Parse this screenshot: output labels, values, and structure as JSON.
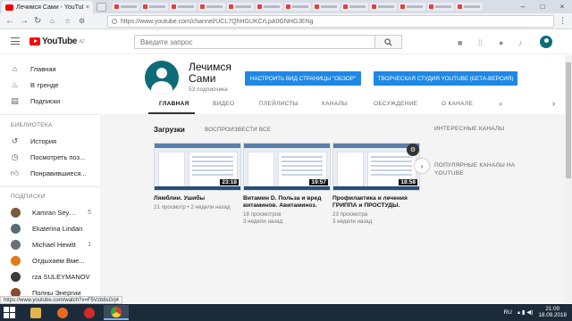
{
  "browser": {
    "tab_title": "Лечимся Сами - YouTube",
    "tab_close": "×",
    "url": "https://www.youtube.com/channel/UCL7QhHGUKCrLpA0GNHGJENg",
    "window_controls": [
      "–",
      "□",
      "×"
    ]
  },
  "header": {
    "logo_text": "YouTube",
    "logo_region": "AZ",
    "search_placeholder": "Введите запрос"
  },
  "sidebar": {
    "main_items": [
      {
        "label": "Главная",
        "icon": "home-icon"
      },
      {
        "label": "В тренде",
        "icon": "flame-icon"
      },
      {
        "label": "Подписки",
        "icon": "subscriptions-icon"
      }
    ],
    "library_heading": "БИБЛИОТЕКА",
    "library_items": [
      {
        "label": "История",
        "icon": "history-icon"
      },
      {
        "label": "Посмотреть поз...",
        "icon": "clock-icon"
      },
      {
        "label": "Понравившиеся...",
        "icon": "thumbs-up-icon"
      }
    ],
    "subs_heading": "ПОДПИСКИ",
    "subscriptions": [
      {
        "label": "Kamran Seyidov",
        "count": "5",
        "color": "#7a5a3a"
      },
      {
        "label": "Ekaterina Lindan",
        "count": "",
        "color": "#556b7a"
      },
      {
        "label": "Michael Hewitt",
        "count": "1",
        "color": "#6a6f78"
      },
      {
        "label": "Отдыхаем Вме...",
        "count": "",
        "color": "#e07b1a"
      },
      {
        "label": "rza SULEYMANOV",
        "count": "",
        "color": "#3b3b3b"
      },
      {
        "label": "Полны Энергии",
        "count": "",
        "color": "#8a4a2a"
      }
    ]
  },
  "channel": {
    "name": "Лечимся Сами",
    "subscribers": "53 подписчика",
    "customize_button": "НАСТРОИТЬ ВИД СТРАНИЦЫ \"ОБЗОР\"",
    "studio_button": "ТВОРЧЕСКАЯ СТУДИЯ YOUTUBE (БЕТА-ВЕРСИЯ)",
    "tabs": [
      "ГЛАВНАЯ",
      "ВИДЕО",
      "ПЛЕЙЛИСТЫ",
      "КАНАЛЫ",
      "ОБСУЖДЕНИЕ",
      "О КАНАЛЕ"
    ]
  },
  "uploads": {
    "title": "Загрузки",
    "play_all": "ВОСПРОИЗВЕСТИ ВСЕ",
    "videos": [
      {
        "title": "Лямблии. Ушибы",
        "meta1": "21 просмотр • 2 недели назад",
        "meta2": "",
        "duration": "23:18"
      },
      {
        "title": "Витамин D. Польза и вред витаминов. Авитаминоз.",
        "meta1": "18 просмотров",
        "meta2": "3 недели назад",
        "duration": "19:57"
      },
      {
        "title": "Профилактика и лечения ГРИППА и ПРОСТУДЫ.",
        "meta1": "23 просмотра",
        "meta2": "3 недели назад",
        "duration": "18:58"
      }
    ]
  },
  "right_column": {
    "interesting_channels": "ИНТЕРЕСНЫЕ КАНАЛЫ",
    "popular_channels": "ПОПУЛЯРНЫЕ КАНАЛЫ НА YOUTUBE"
  },
  "status_bar": "https://www.youtube.com/watch?v=F5Vzb8sGrj4",
  "taskbar": {
    "lang": "RU",
    "time": "21:00",
    "date": "18.09.2018"
  },
  "colors": {
    "accent_blue": "#1e88e5",
    "youtube_red": "#ff0000",
    "channel_avatar": "#0e6b78"
  }
}
